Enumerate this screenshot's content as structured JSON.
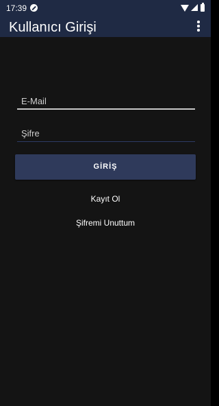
{
  "status_bar": {
    "time": "17:39",
    "icons": [
      "do-not-disturb-icon",
      "wifi-icon",
      "signal-icon",
      "battery-icon"
    ]
  },
  "app_bar": {
    "title": "Kullanıcı Girişi",
    "menu_icon": "more-vert-icon",
    "background": "#1f2a44"
  },
  "form": {
    "email": {
      "placeholder": "E-Mail",
      "value": ""
    },
    "password": {
      "placeholder": "Şifre",
      "value": ""
    },
    "login_label": "GİRİŞ",
    "register_label": "Kayıt Ol",
    "forgot_label": "Şifremi Unuttum"
  },
  "colors": {
    "background": "#141414",
    "button": "#2f3a5b",
    "text": "#ffffff"
  }
}
